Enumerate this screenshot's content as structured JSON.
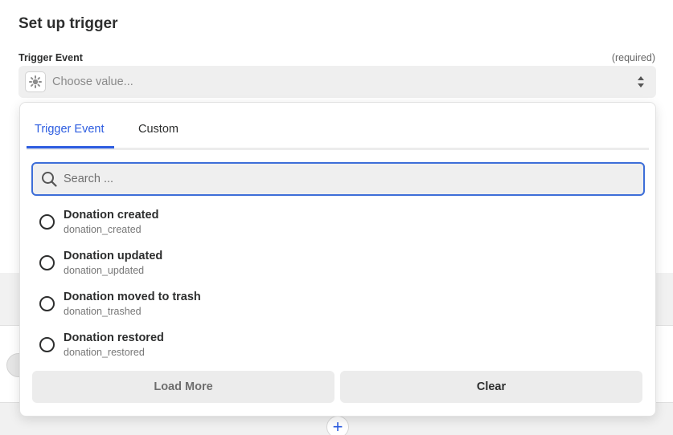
{
  "page": {
    "title": "Set up trigger"
  },
  "field": {
    "label": "Trigger Event",
    "required": "(required)",
    "placeholder": "Choose value...",
    "icon": "gear-icon"
  },
  "dropdown": {
    "tabs": [
      {
        "label": "Trigger Event",
        "active": true
      },
      {
        "label": "Custom",
        "active": false
      }
    ],
    "search": {
      "placeholder": "Search ...",
      "value": ""
    },
    "options": [
      {
        "label": "Donation created",
        "key": "donation_created"
      },
      {
        "label": "Donation updated",
        "key": "donation_updated"
      },
      {
        "label": "Donation moved to trash",
        "key": "donation_trashed"
      },
      {
        "label": "Donation restored",
        "key": "donation_restored"
      }
    ],
    "buttons": {
      "load_more": "Load More",
      "clear": "Clear"
    }
  },
  "colors": {
    "accent": "#2c5ce0",
    "search_border": "#3d6ed8"
  }
}
